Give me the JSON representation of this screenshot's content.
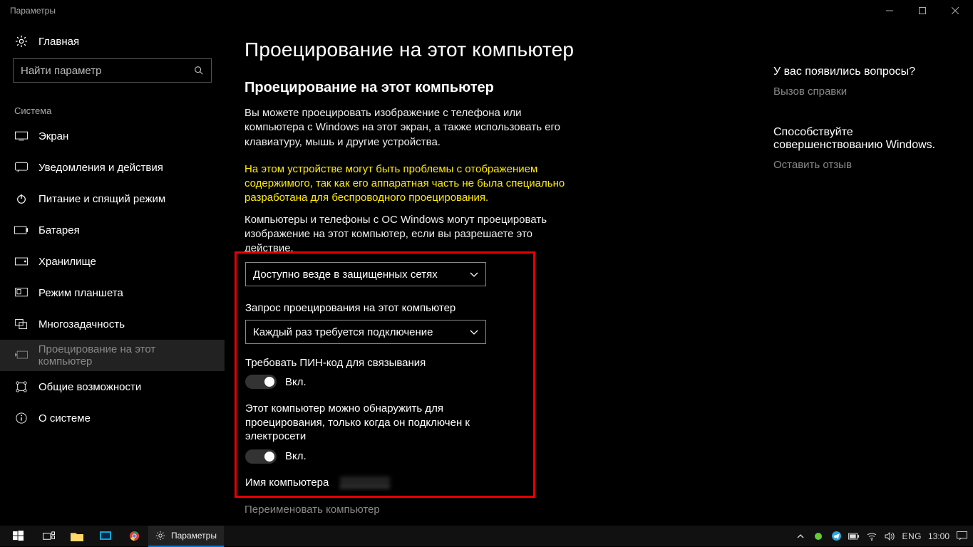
{
  "window": {
    "title": "Параметры"
  },
  "sidebar": {
    "home_label": "Главная",
    "search_placeholder": "Найти параметр",
    "section": "Система",
    "items": [
      {
        "icon": "display-icon",
        "label": "Экран"
      },
      {
        "icon": "notify-icon",
        "label": "Уведомления и действия"
      },
      {
        "icon": "power-icon",
        "label": "Питание и спящий режим"
      },
      {
        "icon": "battery-icon",
        "label": "Батарея"
      },
      {
        "icon": "storage-icon",
        "label": "Хранилище"
      },
      {
        "icon": "tablet-icon",
        "label": "Режим планшета"
      },
      {
        "icon": "multitask-icon",
        "label": "Многозадачность"
      },
      {
        "icon": "project-icon",
        "label": "Проецирование на этот компьютер"
      },
      {
        "icon": "shared-icon",
        "label": "Общие возможности"
      },
      {
        "icon": "info-icon",
        "label": "О системе"
      }
    ],
    "active_index": 7
  },
  "main": {
    "page_title": "Проецирование на этот компьютер",
    "section_title": "Проецирование на этот компьютер",
    "description": "Вы можете проецировать изображение с телефона или компьютера с Windows на этот экран, а также использовать его клавиатуру, мышь и другие устройства.",
    "warning": "На этом устройстве могут быть проблемы с отображением содержимого, так как его аппаратная часть не была специально разработана для беспроводного проецирования.",
    "allow_text": "Компьютеры и телефоны с ОС Windows могут проецировать изображение на этот компьютер, если вы разрешаете это действие.",
    "dropdown1_value": "Доступно везде в защищенных сетях",
    "ask_label": "Запрос проецирования на этот компьютер",
    "dropdown2_value": "Каждый раз требуется подключение",
    "pin_label": "Требовать ПИН-код для связывания",
    "toggle_on": "Вкл.",
    "discover_label": "Этот компьютер можно обнаружить для проецирования, только когда он подключен к электросети",
    "pc_name_label": "Имя компьютера",
    "rename_link": "Переименовать компьютер"
  },
  "right": {
    "questions": "У вас появились вопросы?",
    "help": "Вызов справки",
    "improve": "Способствуйте совершенствованию Windows.",
    "feedback": "Оставить отзыв"
  },
  "taskbar": {
    "app_label": "Параметры",
    "lang": "ENG",
    "clock": "13:00"
  }
}
